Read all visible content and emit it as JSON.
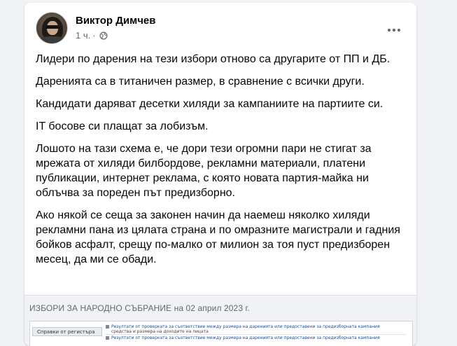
{
  "post": {
    "author_name": "Виктор Димчев",
    "timestamp": "1 ч.",
    "separator": "·",
    "privacy_icon": "globe-icon",
    "more_icon": "more-options-icon",
    "paragraphs": [
      "Лидери по дарения на тези избори отново са другарите от ПП и ДБ.",
      "Даренията са в титаничен размер, в сравнение с всички други.",
      "Кандидати даряват десетки хиляди за кампаниите на партиите си.",
      "IT босове си плащат за лобизъм.",
      "Лошото на тази схема е, че дори тези огромни пари не стигат за мрежата от хиляди билбордове, рекламни материали, платени публикации, интернет реклама, с която новата партия-майка ни облъчва за пореден път предизборно.",
      "Ако някой се сеща за законен начин да наемеш няколко хиляди рекламни пана из цялата страна и по омразните магистрали и гадния бойков асфалт, срещу по-малко от милион за тоя пуст предизборен месец, да ми се обади."
    ]
  },
  "link_preview": {
    "title": "ИЗБОРИ ЗА НАРОДНО СЪБРАНИЕ на 02 април 2023 г.",
    "sidebar_button": "Справки от регистъра",
    "row1": "Резултати от проверката за съответствие между размера на даренията или предоставени за предизборната кампания",
    "row1b": "средства и размера на доходите на лицата",
    "row2": "Резултати от проверката за съответствие между размера на даренията или предоставени за предизборната кампания"
  },
  "colors": {
    "background": "#f0f2f5",
    "card": "#ffffff",
    "text_primary": "#050505",
    "text_secondary": "#65676b"
  }
}
